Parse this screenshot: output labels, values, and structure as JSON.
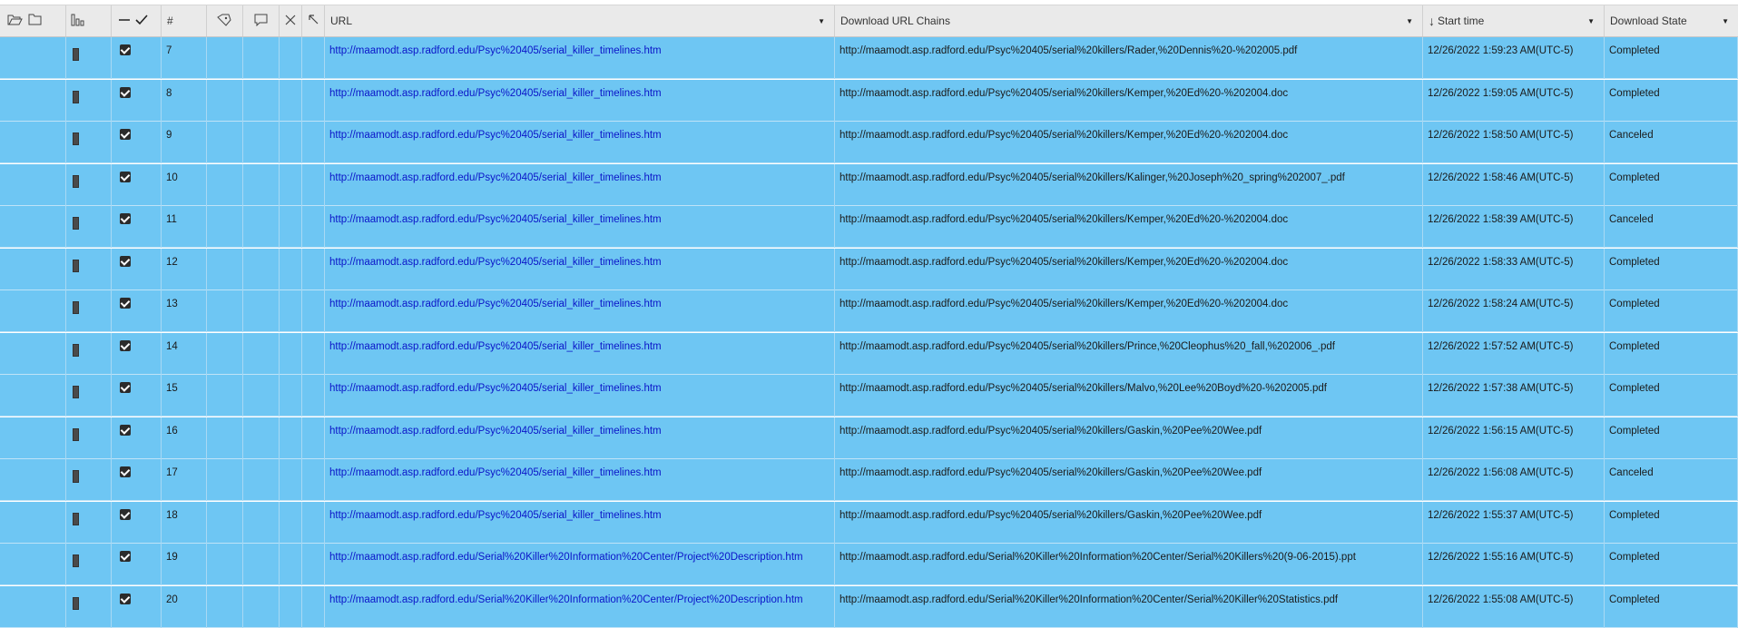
{
  "header": {
    "num_label": "#",
    "url_label": "URL",
    "chains_label": "Download URL Chains",
    "start_label": "Start time",
    "state_label": "Download State",
    "sort_arrow": "↓",
    "dropdown_glyph": "▼"
  },
  "rows": [
    {
      "num": "7",
      "url": "http://maamodt.asp.radford.edu/Psyc%20405/serial_killer_timelines.htm",
      "chain": "http://maamodt.asp.radford.edu/Psyc%20405/serial%20killers/Rader,%20Dennis%20-%202005.pdf",
      "start": "12/26/2022 1:59:23 AM(UTC-5)",
      "state": "Completed"
    },
    {
      "num": "8",
      "url": "http://maamodt.asp.radford.edu/Psyc%20405/serial_killer_timelines.htm",
      "chain": "http://maamodt.asp.radford.edu/Psyc%20405/serial%20killers/Kemper,%20Ed%20-%202004.doc",
      "start": "12/26/2022 1:59:05 AM(UTC-5)",
      "state": "Completed"
    },
    {
      "num": "9",
      "url": "http://maamodt.asp.radford.edu/Psyc%20405/serial_killer_timelines.htm",
      "chain": "http://maamodt.asp.radford.edu/Psyc%20405/serial%20killers/Kemper,%20Ed%20-%202004.doc",
      "start": "12/26/2022 1:58:50 AM(UTC-5)",
      "state": "Canceled"
    },
    {
      "num": "10",
      "url": "http://maamodt.asp.radford.edu/Psyc%20405/serial_killer_timelines.htm",
      "chain": "http://maamodt.asp.radford.edu/Psyc%20405/serial%20killers/Kalinger,%20Joseph%20_spring%202007_.pdf",
      "start": "12/26/2022 1:58:46 AM(UTC-5)",
      "state": "Completed"
    },
    {
      "num": "11",
      "url": "http://maamodt.asp.radford.edu/Psyc%20405/serial_killer_timelines.htm",
      "chain": "http://maamodt.asp.radford.edu/Psyc%20405/serial%20killers/Kemper,%20Ed%20-%202004.doc",
      "start": "12/26/2022 1:58:39 AM(UTC-5)",
      "state": "Canceled"
    },
    {
      "num": "12",
      "url": "http://maamodt.asp.radford.edu/Psyc%20405/serial_killer_timelines.htm",
      "chain": "http://maamodt.asp.radford.edu/Psyc%20405/serial%20killers/Kemper,%20Ed%20-%202004.doc",
      "start": "12/26/2022 1:58:33 AM(UTC-5)",
      "state": "Completed"
    },
    {
      "num": "13",
      "url": "http://maamodt.asp.radford.edu/Psyc%20405/serial_killer_timelines.htm",
      "chain": "http://maamodt.asp.radford.edu/Psyc%20405/serial%20killers/Kemper,%20Ed%20-%202004.doc",
      "start": "12/26/2022 1:58:24 AM(UTC-5)",
      "state": "Completed"
    },
    {
      "num": "14",
      "url": "http://maamodt.asp.radford.edu/Psyc%20405/serial_killer_timelines.htm",
      "chain": "http://maamodt.asp.radford.edu/Psyc%20405/serial%20killers/Prince,%20Cleophus%20_fall,%202006_.pdf",
      "start": "12/26/2022 1:57:52 AM(UTC-5)",
      "state": "Completed"
    },
    {
      "num": "15",
      "url": "http://maamodt.asp.radford.edu/Psyc%20405/serial_killer_timelines.htm",
      "chain": "http://maamodt.asp.radford.edu/Psyc%20405/serial%20killers/Malvo,%20Lee%20Boyd%20-%202005.pdf",
      "start": "12/26/2022 1:57:38 AM(UTC-5)",
      "state": "Completed"
    },
    {
      "num": "16",
      "url": "http://maamodt.asp.radford.edu/Psyc%20405/serial_killer_timelines.htm",
      "chain": "http://maamodt.asp.radford.edu/Psyc%20405/serial%20killers/Gaskin,%20Pee%20Wee.pdf",
      "start": "12/26/2022 1:56:15 AM(UTC-5)",
      "state": "Completed"
    },
    {
      "num": "17",
      "url": "http://maamodt.asp.radford.edu/Psyc%20405/serial_killer_timelines.htm",
      "chain": "http://maamodt.asp.radford.edu/Psyc%20405/serial%20killers/Gaskin,%20Pee%20Wee.pdf",
      "start": "12/26/2022 1:56:08 AM(UTC-5)",
      "state": "Canceled"
    },
    {
      "num": "18",
      "url": "http://maamodt.asp.radford.edu/Psyc%20405/serial_killer_timelines.htm",
      "chain": "http://maamodt.asp.radford.edu/Psyc%20405/serial%20killers/Gaskin,%20Pee%20Wee.pdf",
      "start": "12/26/2022 1:55:37 AM(UTC-5)",
      "state": "Completed"
    },
    {
      "num": "19",
      "url": "http://maamodt.asp.radford.edu/Serial%20Killer%20Information%20Center/Project%20Description.htm",
      "chain": "http://maamodt.asp.radford.edu/Serial%20Killer%20Information%20Center/Serial%20Killers%20(9-06-2015).ppt",
      "start": "12/26/2022 1:55:16 AM(UTC-5)",
      "state": "Completed"
    },
    {
      "num": "20",
      "url": "http://maamodt.asp.radford.edu/Serial%20Killer%20Information%20Center/Project%20Description.htm",
      "chain": "http://maamodt.asp.radford.edu/Serial%20Killer%20Information%20Center/Serial%20Killer%20Statistics.pdf",
      "start": "12/26/2022 1:55:08 AM(UTC-5)",
      "state": "Completed"
    }
  ],
  "icons": {
    "open_folder": "folder-open-icon",
    "folder": "folder-icon",
    "bars": "bar-chart-icon",
    "minus": "minus-icon",
    "check": "check-icon",
    "tag": "tag-icon",
    "comment": "comment-icon",
    "close": "close-icon",
    "arrow": "arrow-up-left-icon"
  },
  "colors": {
    "row_bg": "#6ec6f3",
    "header_bg": "#eaeaea",
    "link": "#0a14c8"
  }
}
